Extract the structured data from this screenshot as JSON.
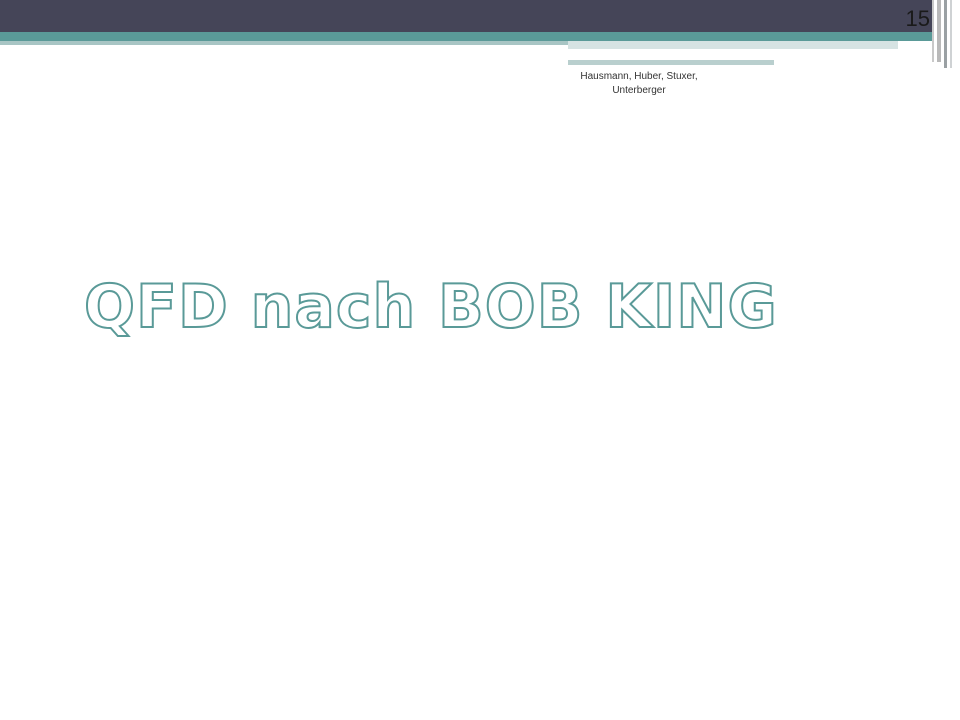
{
  "slide": {
    "number": "15",
    "footer": "Hausmann, Huber, Stuxer, Unterberger",
    "title": "QFD nach BOB KING"
  },
  "colors": {
    "top_bar": "#454558",
    "accent_teal": "#5a9a98",
    "title_outline": "#5a9a98",
    "background": "#ffffff"
  }
}
